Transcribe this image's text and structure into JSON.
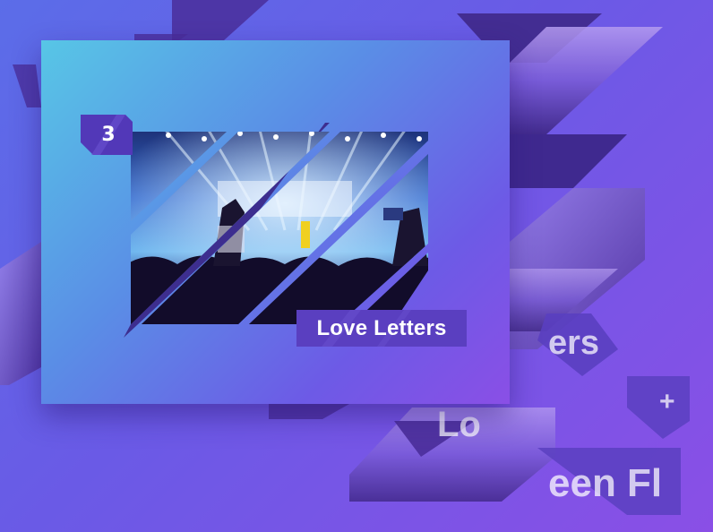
{
  "card": {
    "number": "3",
    "title": "Love Letters"
  },
  "background_fragments": {
    "ghost_1": "ers",
    "ghost_2": "Lo",
    "ghost_3": "een Fl",
    "ghost_4": "+"
  },
  "colors": {
    "background_start": "#5b6de8",
    "background_end": "#8a4fe6",
    "card_start": "#57c6e6",
    "card_end": "#8a4fe6",
    "tag": "#5a3fc0",
    "badge": "#5238b8"
  }
}
